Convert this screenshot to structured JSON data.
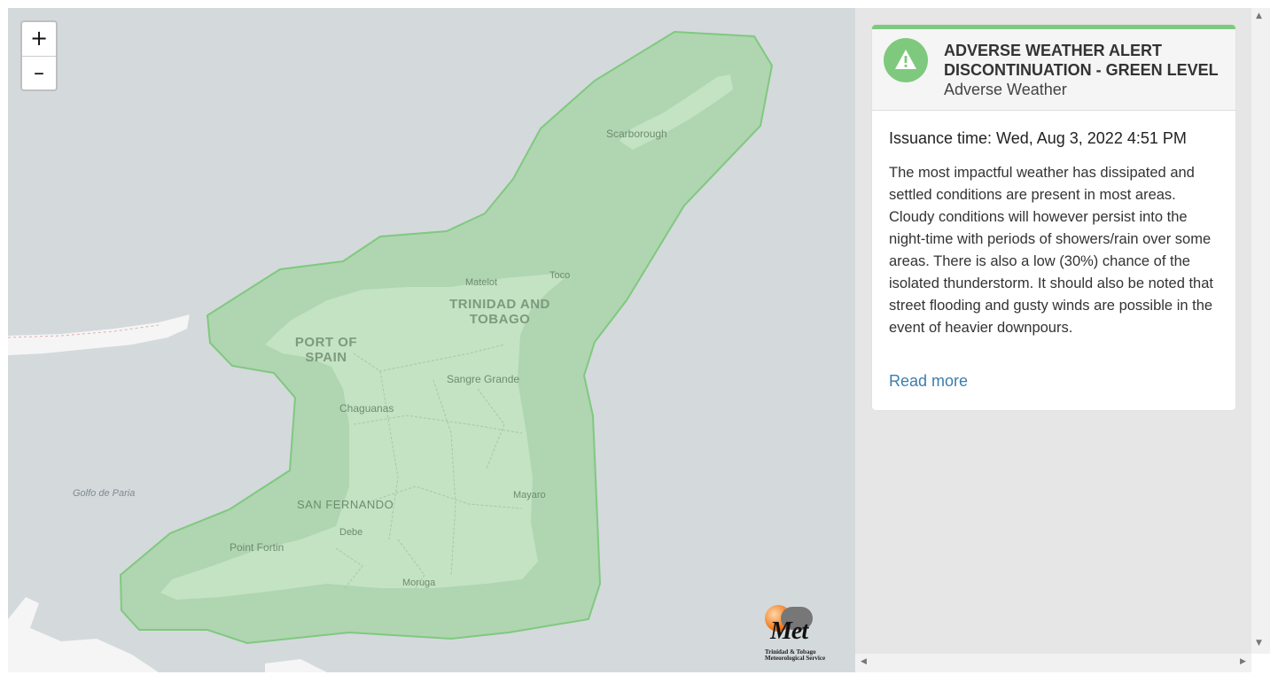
{
  "map": {
    "zoom_in_label": "+",
    "zoom_out_label": "–",
    "labels": {
      "scarborough": "Scarborough",
      "matelot": "Matelot",
      "toco": "Toco",
      "country_line1": "TRINIDAD AND",
      "country_line2": "TOBAGO",
      "pos_line1": "PORT OF",
      "pos_line2": "SPAIN",
      "sangre_grande": "Sangre Grande",
      "chaguanas": "Chaguanas",
      "golfo": "Golfo de Paria",
      "mayaro": "Mayaro",
      "san_fernando": "SAN FERNANDO",
      "debe": "Debe",
      "point_fortin": "Point Fortin",
      "moruga": "Moruga"
    },
    "alert_zone_color": "#7fc97f",
    "land_color": "#c3e3c3",
    "water_color": "#d4d9dc",
    "logo": {
      "text": "Met",
      "subtitle_line1": "Trinidad & Tobago",
      "subtitle_line2": "Meteorological Service"
    }
  },
  "alert": {
    "title": "ADVERSE WEATHER ALERT DISCONTINUATION - GREEN LEVEL",
    "category": "Adverse Weather",
    "level_color": "#7fc97f",
    "icon": "warning-triangle-icon",
    "issuance": "Issuance time: Wed, Aug 3, 2022 4:51 PM",
    "description": "The most impactful weather has dissipated and settled conditions are present in most areas. Cloudy conditions will however persist into the night-time with periods of showers/rain over some areas. There is also a low (30%) chance of the isolated thunderstorm. It should also be noted that street flooding and gusty winds are possible in the event of heavier downpours.",
    "read_more": "Read more"
  }
}
